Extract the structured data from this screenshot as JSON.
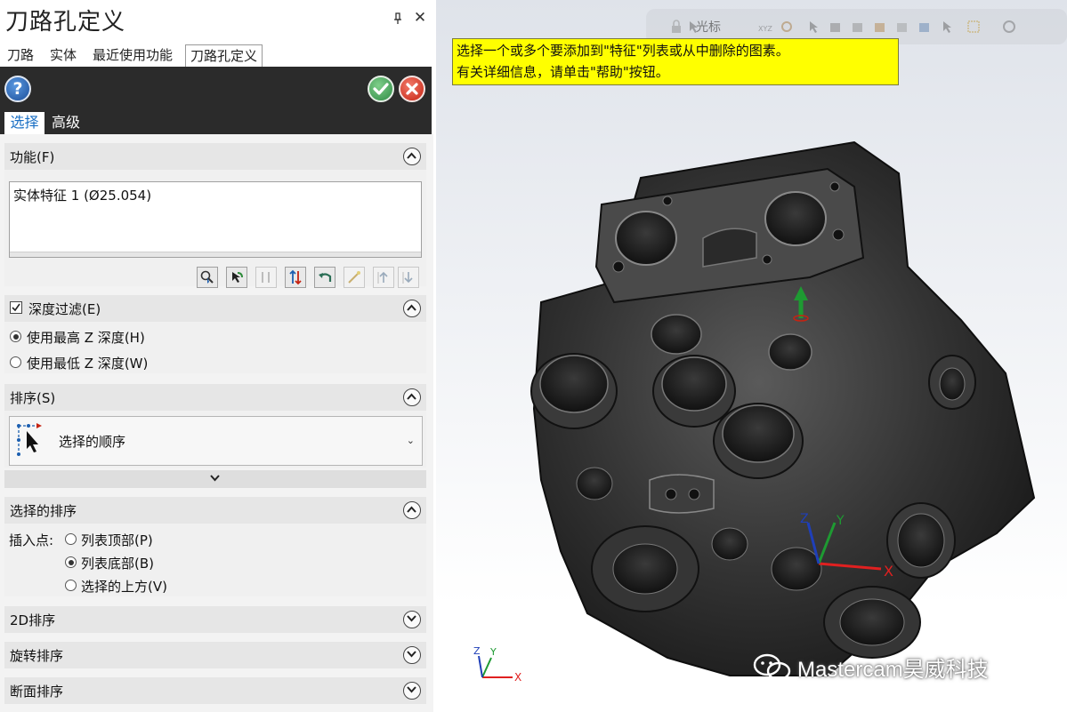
{
  "panel": {
    "title": "刀路孔定义",
    "tabs": [
      "刀路",
      "实体",
      "最近使用功能",
      "刀路孔定义"
    ],
    "subtabs": {
      "select": "选择",
      "advanced": "高级"
    },
    "help_label": "?"
  },
  "function_section": {
    "title": "功能(F)",
    "list_items": [
      "实体特征 1 (Ø25.054)"
    ]
  },
  "depth_section": {
    "checkbox_label": "深度过滤(E)",
    "checked": true,
    "options": [
      "使用最高 Z 深度(H)",
      "使用最低 Z 深度(W)"
    ],
    "selected": 0
  },
  "sort_section": {
    "title": "排序(S)",
    "selected_value": "选择的顺序"
  },
  "selection_sort": {
    "title": "选择的排序",
    "insert_label": "插入点:",
    "options": [
      "列表顶部(P)",
      "列表底部(B)",
      "选择的上方(V)"
    ],
    "selected": 1
  },
  "collapsed_sections": [
    "2D排序",
    "旋转排序",
    "断面排序"
  ],
  "viewport": {
    "toolbar_cursor_label": "光标",
    "tip_lines": [
      "选择一个或多个要添加到\"特征\"列表或从中删除的图素。",
      "有关详细信息，请单击\"帮助\"按钮。"
    ],
    "axis_labels": {
      "x": "X",
      "y": "Y",
      "z": "Z"
    },
    "watermark": "Mastercam昊威科技"
  },
  "colors": {
    "accent_blue": "#1a6fc4",
    "tip_yellow": "#ffff00",
    "ok_green": "#2f8b45",
    "cancel_red": "#c52312"
  }
}
